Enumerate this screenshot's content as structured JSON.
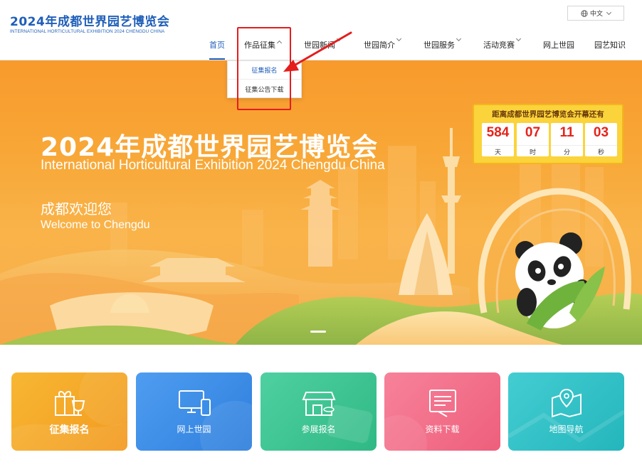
{
  "logo": {
    "title": "2024年成都世界园艺博览会",
    "subtitle": "INTERNATIONAL HORTICULTURAL EXHIBITION 2024 CHENGDU CHINA"
  },
  "language": {
    "label": "中文"
  },
  "nav": {
    "items": [
      {
        "label": "首页"
      },
      {
        "label": "作品征集"
      },
      {
        "label": "世园新闻"
      },
      {
        "label": "世园简介"
      },
      {
        "label": "世园服务"
      },
      {
        "label": "活动竞赛"
      },
      {
        "label": "网上世园"
      },
      {
        "label": "园艺知识"
      }
    ],
    "dropdown": [
      {
        "label": "征集报名"
      },
      {
        "label": "征集公告下载"
      }
    ]
  },
  "banner": {
    "title": "2024年成都世界园艺博览会",
    "subtitle": "International Horticultural Exhibition 2024 Chengdu China",
    "welcome_cn": "成都欢迎您",
    "welcome_en": "Welcome to Chengdu"
  },
  "countdown": {
    "title": "距离成都世界园艺博览会开幕还有",
    "cells": [
      {
        "value": "584",
        "unit": "天"
      },
      {
        "value": "07",
        "unit": "时"
      },
      {
        "value": "11",
        "unit": "分"
      },
      {
        "value": "03",
        "unit": "秒"
      }
    ]
  },
  "cards": [
    {
      "label": "征集报名",
      "icon": "gift-trophy-icon",
      "color": "#f5a526"
    },
    {
      "label": "网上世园",
      "icon": "devices-icon",
      "color": "#3b8fe8"
    },
    {
      "label": "参展报名",
      "icon": "store-icon",
      "color": "#3ec38f"
    },
    {
      "label": "资料下载",
      "icon": "document-icon",
      "color": "#f06f8a"
    },
    {
      "label": "地图导航",
      "icon": "map-pin-icon",
      "color": "#33c2c7"
    }
  ],
  "colors": {
    "brand_blue": "#1f5fb9",
    "highlight_red": "#e41d1d",
    "banner_orange": "#f8a838"
  }
}
